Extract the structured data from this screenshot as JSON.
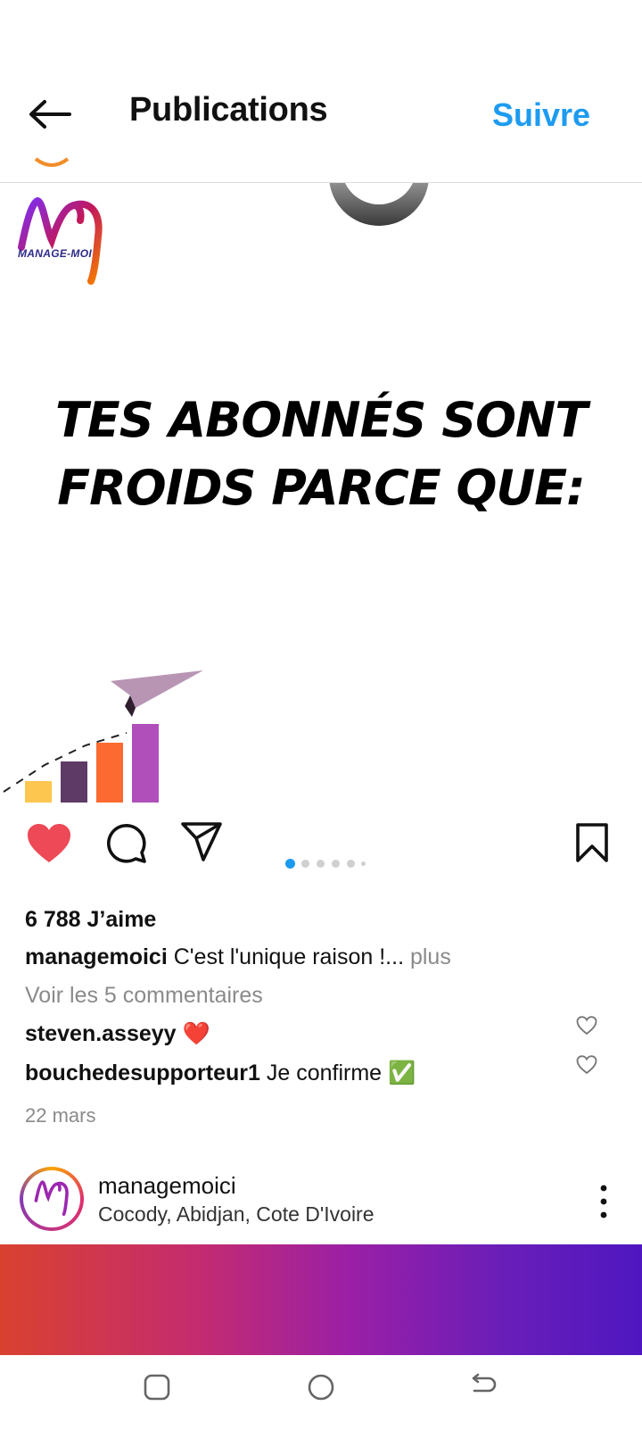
{
  "header": {
    "title": "Publications",
    "follow_label": "Suivre",
    "back_icon": "arrow-left-icon"
  },
  "post": {
    "logo_text": "MANAGE-MOI",
    "headline_line1": "TES ABONNÉS SONT",
    "headline_line2": "FROIDS PARCE QUE:",
    "carousel": {
      "count": 6,
      "active_index": 0
    },
    "likes": "6 788 J’aime",
    "caption_user": "managemoici",
    "caption_text": " C'est l'unique raison !...",
    "caption_more": " plus",
    "view_comments": "Voir les 5 commentaires",
    "comments": [
      {
        "user": "steven.asseyy",
        "text": " ❤️"
      },
      {
        "user": "bouchedesupporteur1",
        "text": " Je confirme ✅"
      }
    ],
    "date": "22 mars"
  },
  "next_post": {
    "username": "managemoici",
    "location": "Cocody, Abidjan, Cote D'Ivoire"
  },
  "colors": {
    "accent_blue": "#1d9bf0",
    "like_red": "#ed4956",
    "bar_yellow": "#fdc64e",
    "bar_plum": "#5e3a66",
    "bar_orange": "#fd6a31",
    "bar_purple": "#b04fba",
    "plane": "#b995b4"
  },
  "icons": {
    "like": "heart-filled-icon",
    "comment": "comment-bubble-icon",
    "share": "paper-plane-icon",
    "save": "bookmark-icon",
    "comment_like": "heart-outline-icon",
    "more": "vertical-dots-icon",
    "nav_recent": "square-icon",
    "nav_home": "circle-icon",
    "nav_back": "back-arrow-icon"
  }
}
